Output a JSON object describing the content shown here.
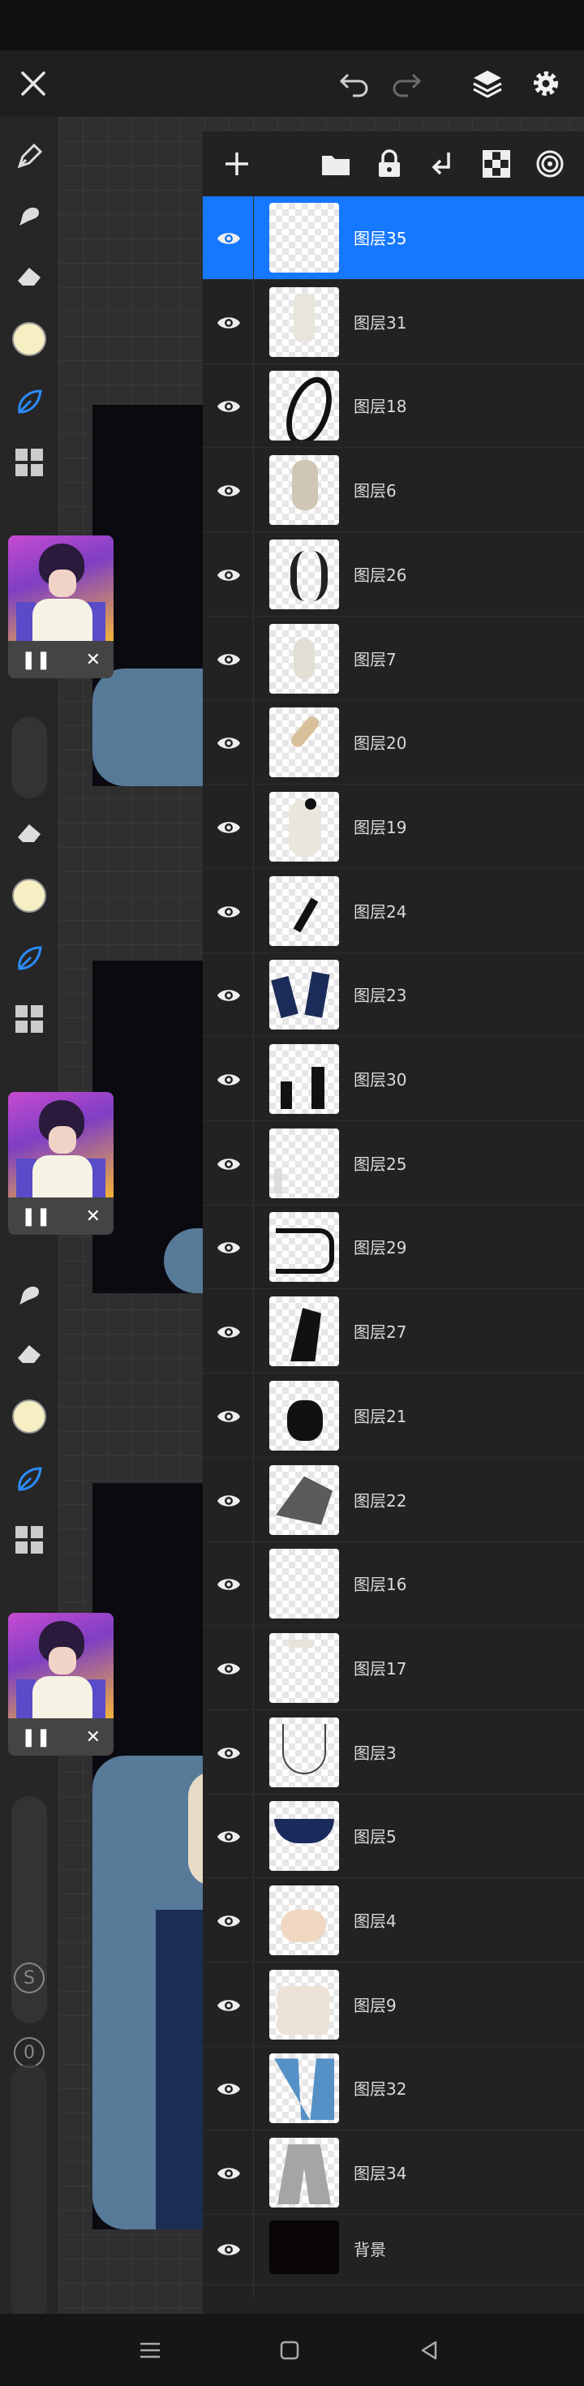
{
  "layers_panel": {
    "layers": [
      {
        "name": "图层35",
        "selected": true,
        "visible": true
      },
      {
        "name": "图层31",
        "visible": true
      },
      {
        "name": "图层18",
        "visible": true
      },
      {
        "name": "图层6",
        "visible": true
      },
      {
        "name": "图层26",
        "visible": true
      },
      {
        "name": "图层7",
        "visible": true
      },
      {
        "name": "图层20",
        "visible": true
      },
      {
        "name": "图层19",
        "visible": true
      },
      {
        "name": "图层24",
        "visible": true
      },
      {
        "name": "图层23",
        "visible": true
      },
      {
        "name": "图层30",
        "visible": true
      },
      {
        "name": "图层25",
        "visible": true
      },
      {
        "name": "图层29",
        "visible": true
      },
      {
        "name": "图层27",
        "visible": true
      },
      {
        "name": "图层21",
        "visible": true
      },
      {
        "name": "图层22",
        "visible": true
      },
      {
        "name": "图层16",
        "visible": true
      },
      {
        "name": "图层17",
        "visible": true
      },
      {
        "name": "图层3",
        "visible": true
      },
      {
        "name": "图层5",
        "visible": true
      },
      {
        "name": "图层4",
        "visible": true
      },
      {
        "name": "图层9",
        "visible": true
      },
      {
        "name": "图层32",
        "visible": true
      },
      {
        "name": "图层34",
        "visible": true
      },
      {
        "name": "背景",
        "visible": true,
        "background": true
      }
    ]
  },
  "left_toolbar": {
    "s_label": "S",
    "zero_label": "0"
  },
  "colors": {
    "selected_layer": "#1677ff",
    "current_color": "#f6efc4",
    "accent_tool": "#2a8cff"
  }
}
